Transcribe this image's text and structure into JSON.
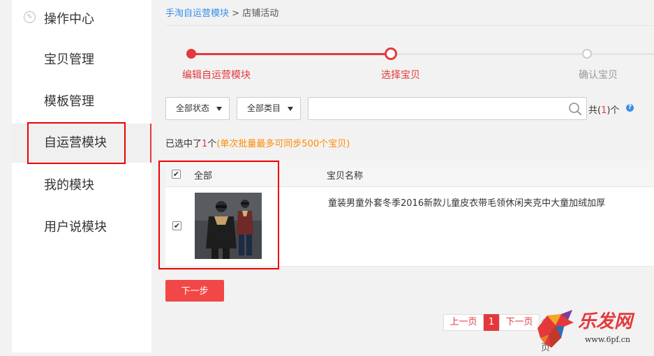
{
  "sidebar": {
    "header": "操作中心",
    "header_icon": "wand-icon",
    "items": [
      {
        "label": "宝贝管理"
      },
      {
        "label": "模板管理"
      },
      {
        "label": "自运营模块",
        "active": true
      },
      {
        "label": "我的模块"
      },
      {
        "label": "用户说模块"
      }
    ]
  },
  "breadcrumb": {
    "link": "手淘自运营模块",
    "separator": ">",
    "current": "店铺活动"
  },
  "steps": [
    {
      "label": "编辑自运营模块",
      "state": "done"
    },
    {
      "label": "选择宝贝",
      "state": "current"
    },
    {
      "label": "确认宝贝",
      "state": "pending"
    }
  ],
  "filters": {
    "status": "全部状态",
    "category": "全部类目",
    "search_value": "",
    "total_prefix": "共(",
    "total_count": "1",
    "total_suffix": ")个"
  },
  "selection": {
    "prefix": "已选中了",
    "count": "1",
    "unit": "个",
    "note": "(单次批量最多可同步500个宝贝)"
  },
  "table": {
    "headers": {
      "all": "全部",
      "name": "宝贝名称"
    },
    "rows": [
      {
        "checked": true,
        "title": "童装男童外套冬季2016新款儿童皮衣带毛领休闲夹克中大童加绒加厚"
      }
    ]
  },
  "actions": {
    "next": "下一步"
  },
  "pagination": {
    "prev": "上一页",
    "current": "1",
    "next": "下一页",
    "total": "共1页"
  },
  "watermark": {
    "name": "乐发网",
    "url": "www.6pf.cn"
  },
  "colors": {
    "accent": "#e4393c",
    "link": "#3a8ee6",
    "orange": "#ff8a00",
    "button": "#f24747"
  }
}
